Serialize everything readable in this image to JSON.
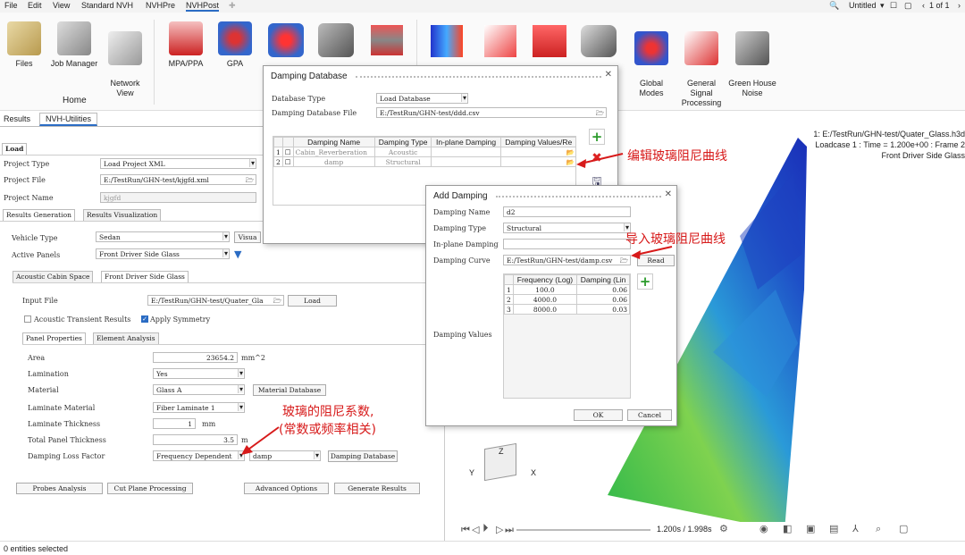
{
  "menubar": {
    "items": [
      "File",
      "Edit",
      "View",
      "Standard NVH",
      "NVHPre",
      "NVHPost"
    ],
    "right": {
      "doc_title": "Untitled",
      "page_nav": "1 of 1"
    }
  },
  "ribbon": {
    "home": [
      {
        "label": "Files",
        "icon": "folder-icon"
      },
      {
        "label": "Job Manager",
        "icon": "job-manager-icon"
      },
      {
        "label": "Network\nView",
        "icon": "network-view-icon"
      }
    ],
    "home_label": "Home",
    "post": [
      {
        "label": "MPA/PPA",
        "icon": "mpa-ppa-icon"
      },
      {
        "label": "GPA",
        "icon": "gpa-icon"
      }
    ],
    "post_right": [
      {
        "label": "Global\nModes",
        "icon": "global-modes-icon"
      },
      {
        "label": "General\nSignal\nProcessing",
        "icon": "signal-processing-icon"
      },
      {
        "label": "Green House\nNoise",
        "icon": "green-house-icon"
      }
    ]
  },
  "left": {
    "tabs": [
      "Results",
      "NVH-Utilities"
    ],
    "load_tab": "Load",
    "project_type_label": "Project Type",
    "project_type": "Load Project XML",
    "project_file_label": "Project File",
    "project_file": "E:/TestRun/GHN-test/kjgfd.xml",
    "project_name_label": "Project Name",
    "project_name": "kjgfd",
    "sub_tabs": [
      "Results Generation",
      "Results Visualization"
    ],
    "vehicle_type_label": "Vehicle Type",
    "vehicle_type": "Sedan",
    "visual_btn": "Visua",
    "active_panels_label": "Active Panels",
    "active_panels": "Front Driver Side Glass",
    "panel_tabs": [
      "Acoustic Cabin Space",
      "Front Driver Side Glass"
    ],
    "input_file_label": "Input File",
    "input_file": "E:/TestRun/GHN-test/Quater_Gla",
    "load_btn": "Load",
    "acoustic_transient": "Acoustic Transient Results",
    "apply_symmetry": "Apply Symmetry",
    "prop_tabs": [
      "Panel Properties",
      "Element Analysis"
    ],
    "area_label": "Area",
    "area": "23654.2",
    "area_unit": "mm^2",
    "lamination_label": "Lamination",
    "lamination": "Yes",
    "material_label": "Material",
    "material": "Glass A",
    "material_db_btn": "Material Database",
    "laminate_material_label": "Laminate Material",
    "laminate_material": "Fiber Laminate 1",
    "laminate_thickness_label": "Laminate Thickness",
    "laminate_thickness": "1",
    "thickness_unit": "mm",
    "total_thickness_label": "Total Panel Thickness",
    "total_thickness": "3.5",
    "total_unit": "m",
    "dlf_label": "Damping Loss Factor",
    "dlf": "Frequency Dependent",
    "dlf_curve": "damp",
    "damping_db_btn": "Damping Database",
    "bottom_btns": [
      "Probes Analysis",
      "Cut Plane Processing",
      "Advanced Options",
      "Generate Results"
    ]
  },
  "damping_db": {
    "title": "Damping Database",
    "db_type_label": "Database Type",
    "db_type": "Load Database",
    "db_file_label": "Damping Database File",
    "db_file": "E:/TestRun/GHN-test/ddd.csv",
    "columns": [
      "Damping Name",
      "Damping Type",
      "In-plane Damping",
      "Damping Values/Re"
    ],
    "rows": [
      {
        "n": "1",
        "name": "Cabin_Reverberation",
        "type": "Acoustic"
      },
      {
        "n": "2",
        "name": "damp",
        "type": "Structural"
      }
    ]
  },
  "add_damping": {
    "title": "Add Damping",
    "name_label": "Damping Name",
    "name": "d2",
    "type_label": "Damping Type",
    "type": "Structural",
    "inplane_label": "In-plane Damping",
    "curve_label": "Damping Curve",
    "curve": "E:/TestRun/GHN-test/damp.csv",
    "read_btn": "Read",
    "values_label": "Damping Values",
    "columns": [
      "Frequency (Log)",
      "Damping (Lin"
    ],
    "rows": [
      {
        "n": "1",
        "f": "100.0",
        "d": "0.06"
      },
      {
        "n": "2",
        "f": "4000.0",
        "d": "0.06"
      },
      {
        "n": "3",
        "f": "8000.0",
        "d": "0.03"
      }
    ],
    "ok": "OK",
    "cancel": "Cancel"
  },
  "annotations": {
    "edit_curve": "编辑玻璃阻尼曲线",
    "import_curve": "导入玻璃阻尼曲线",
    "coef_line1": "玻璃的阻尼系数,",
    "coef_line2": "(常数或频率相关)"
  },
  "viewport": {
    "file_line": "1: E:/TestRun/GHN-test/Quater_Glass.h3d",
    "loadcase_line": "Loadcase 1 : Time =    1.200e+00 : Frame 2",
    "panel_line": "Front Driver Side Glass",
    "axis_x": "X",
    "axis_y": "Y",
    "axis_z": "Z",
    "time_readout": "1.200s / 1.998s"
  },
  "status": "0 entities selected",
  "colors": {
    "accent": "#2b6cc4",
    "annotation": "#d71a1a"
  }
}
